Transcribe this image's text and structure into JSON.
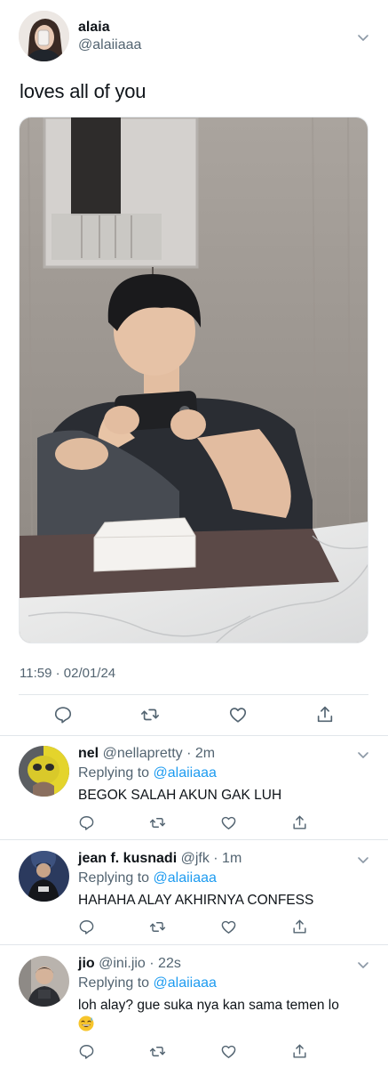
{
  "tweet": {
    "author_name": "alaia",
    "author_handle": "@alaiiaaa",
    "text": "loves all of you",
    "timestamp": "11:59 · 02/01/24",
    "actions": [
      "reply-icon",
      "retweet-icon",
      "like-icon",
      "share-icon"
    ]
  },
  "replies": [
    {
      "name": "nel",
      "meta": "@nellapretty · 2m",
      "replying_prefix": "Replying to",
      "replying_to": "@alaiiaaa",
      "text": "BEGOK SALAH AKUN GAK LUH"
    },
    {
      "name": "jean f. kusnadi",
      "meta": "@jfk · 1m",
      "replying_prefix": "Replying to",
      "replying_to": "@alaiiaaa",
      "text": "HAHAHA ALAY AKHIRNYA CONFESS"
    },
    {
      "name": "jio",
      "meta": "@ini.jio · 22s",
      "replying_prefix": "Replying to",
      "replying_to": "@alaiiaaa",
      "text": "loh alay? gue suka nya kan sama temen lo",
      "emoji": "grinning-sweat-emoji"
    }
  ],
  "colors": {
    "text_primary": "#0f1419",
    "text_secondary": "#536471",
    "accent": "#1d9bf0",
    "divider": "#e1e6ea"
  }
}
